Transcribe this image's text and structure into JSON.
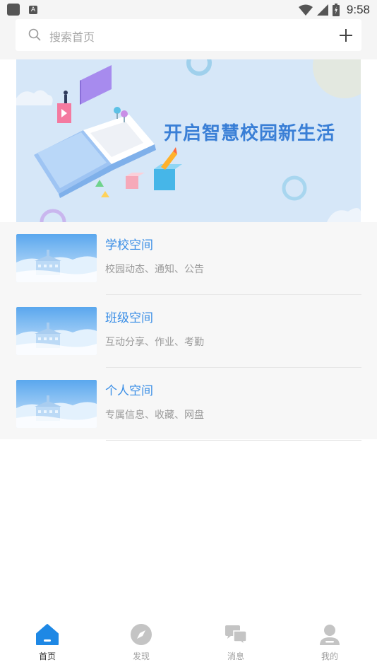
{
  "status_bar": {
    "time": "9:58",
    "icons": [
      "app-square-icon",
      "a-notification-icon",
      "wifi-icon",
      "cell-signal-icon",
      "battery-charging-icon"
    ]
  },
  "search": {
    "placeholder": "搜索首页",
    "add_icon": "plus-icon"
  },
  "banner": {
    "text": "开启智慧校园新生活"
  },
  "spaces": [
    {
      "title": "学校空间",
      "subtitle": "校园动态、通知、公告"
    },
    {
      "title": "班级空间",
      "subtitle": "互动分享、作业、考勤"
    },
    {
      "title": "个人空间",
      "subtitle": "专属信息、收藏、网盘"
    }
  ],
  "bottom_nav": {
    "items": [
      {
        "label": "首页",
        "icon": "home-icon",
        "active": true
      },
      {
        "label": "发现",
        "icon": "compass-icon",
        "active": false
      },
      {
        "label": "消息",
        "icon": "chat-bubbles-icon",
        "active": false
      },
      {
        "label": "我的",
        "icon": "person-icon",
        "active": false
      }
    ]
  },
  "colors": {
    "accent": "#1e88e5",
    "title_blue": "#3a8ee6",
    "banner_bg": "#d6e7f8",
    "inactive_icon": "#c4c4c4"
  }
}
